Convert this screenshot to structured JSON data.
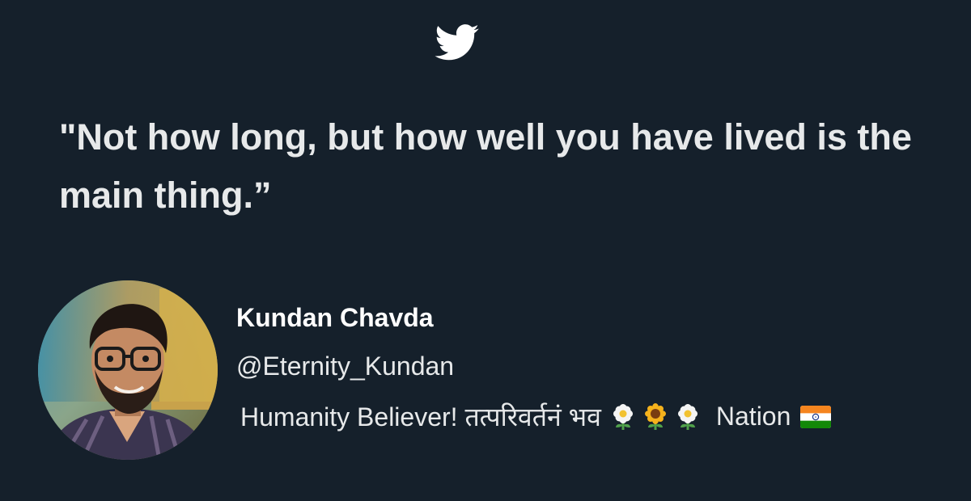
{
  "card": {
    "background": "#15202b",
    "logo_icon": "twitter-bird-icon",
    "logo_color": "#ffffff"
  },
  "quote": {
    "text": "\"Not how long, but how well you have lived is the main thing.”"
  },
  "author": {
    "name": "Kundan Chavda",
    "handle": "@Eternity_Kundan",
    "bio_prefix": "Humanity Believer! तत्परिवर्तनं भव",
    "bio_emojis": [
      "white-flower-icon",
      "sunflower-icon",
      "white-flower-icon"
    ],
    "bio_suffix": "Nation",
    "bio_flag": "india-flag-icon",
    "avatar_icon": "profile-photo"
  }
}
